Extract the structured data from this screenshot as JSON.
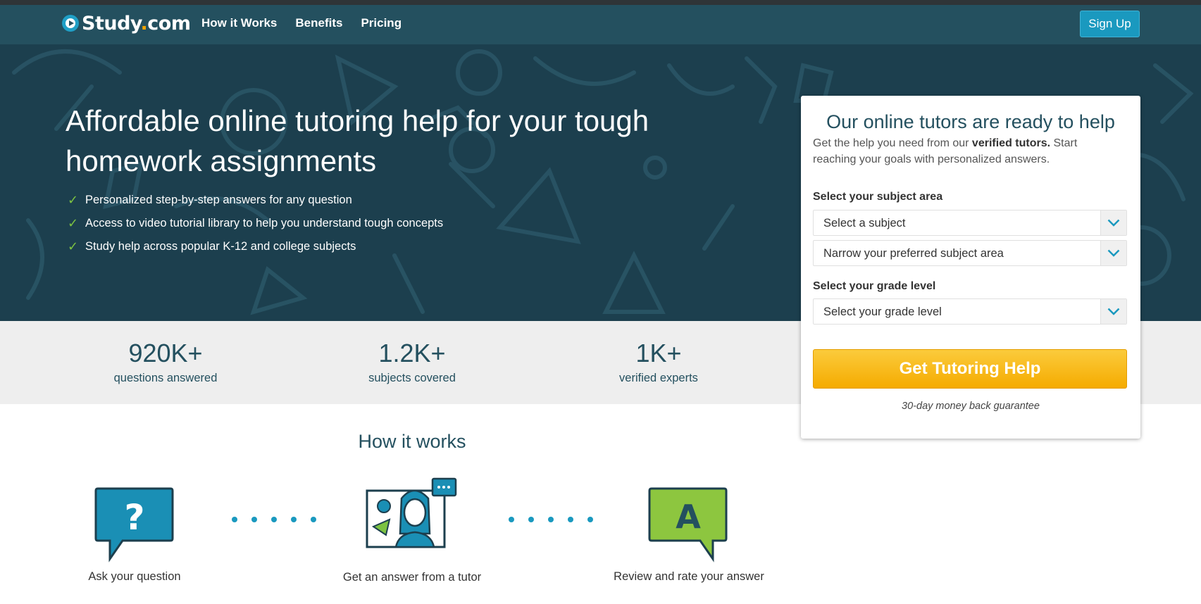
{
  "header": {
    "logo_text": "Study",
    "logo_dot": ".",
    "logo_suffix": "com",
    "nav": [
      "How it Works",
      "Benefits",
      "Pricing"
    ],
    "signup_label": "Sign Up"
  },
  "hero": {
    "title": "Affordable online tutoring help for your tough homework assignments",
    "check_symbol": "✓",
    "bullets": [
      "Personalized step-by-step answers for any question",
      "Access to video tutorial library to help you understand tough concepts",
      "Study help across popular K-12 and college subjects"
    ]
  },
  "stats": [
    {
      "value": "920K+",
      "label": "questions answered"
    },
    {
      "value": "1.2K+",
      "label": "subjects covered"
    },
    {
      "value": "1K+",
      "label": "verified experts"
    }
  ],
  "how": {
    "title": "How it works",
    "steps": [
      {
        "label": "Ask your question",
        "icon": "question-bubble-icon",
        "glyph": "?"
      },
      {
        "label": "Get an answer from a tutor",
        "icon": "tutor-video-icon"
      },
      {
        "label": "Review and rate your answer",
        "icon": "answer-bubble-icon",
        "glyph": "A"
      }
    ]
  },
  "form": {
    "title": "Our online tutors are ready to help",
    "subtitle_prefix": "Get the help you need from our ",
    "subtitle_bold": "verified tutors.",
    "subtitle_suffix": " Start reaching your goals with personalized answers.",
    "subject_label": "Select your subject area",
    "subject_value": "Select a subject",
    "narrow_value": "Narrow your preferred subject area",
    "grade_label": "Select your grade level",
    "grade_value": "Select your grade level",
    "cta_label": "Get Tutoring Help",
    "guarantee": "30-day money back guarantee"
  },
  "colors": {
    "header_bg": "#24505f",
    "hero_bg": "#1c3f4e",
    "accent_blue": "#1a99bf",
    "check_green": "#7cc242",
    "cta_yellow": "#f5ab00"
  }
}
